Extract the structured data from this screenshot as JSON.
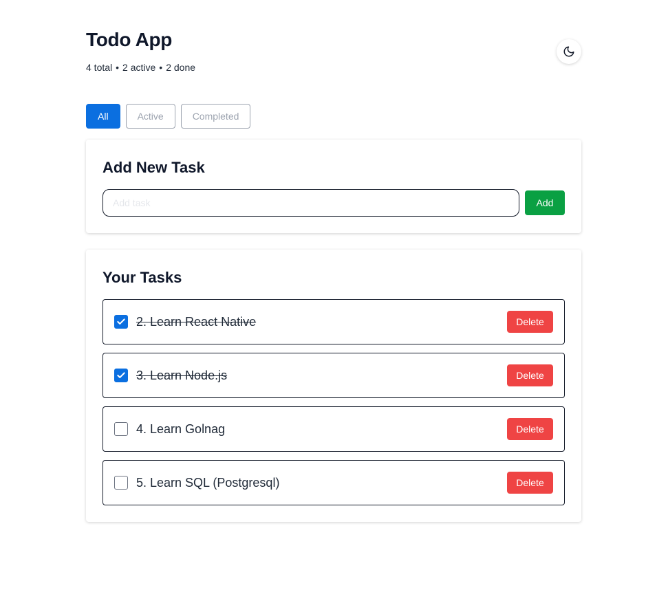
{
  "header": {
    "title": "Todo App",
    "stats": {
      "total": "4 total",
      "active": "2 active",
      "done": "2 done",
      "separator": "•"
    },
    "theme_icon": "moon-icon"
  },
  "filters": [
    {
      "label": "All",
      "active": true
    },
    {
      "label": "Active",
      "active": false
    },
    {
      "label": "Completed",
      "active": false
    }
  ],
  "add_task": {
    "heading": "Add New Task",
    "input_value": "",
    "input_placeholder": "Add task",
    "button_label": "Add"
  },
  "tasks_section": {
    "heading": "Your Tasks",
    "delete_label": "Delete",
    "items": [
      {
        "text": "2. Learn React Native",
        "completed": true
      },
      {
        "text": "3. Learn Node.js",
        "completed": true
      },
      {
        "text": "4. Learn Golnag",
        "completed": false
      },
      {
        "text": "5. Learn SQL (Postgresql)",
        "completed": false
      }
    ]
  },
  "colors": {
    "primary": "#0b6fe0",
    "add": "#0aa043",
    "delete": "#ef4444"
  }
}
